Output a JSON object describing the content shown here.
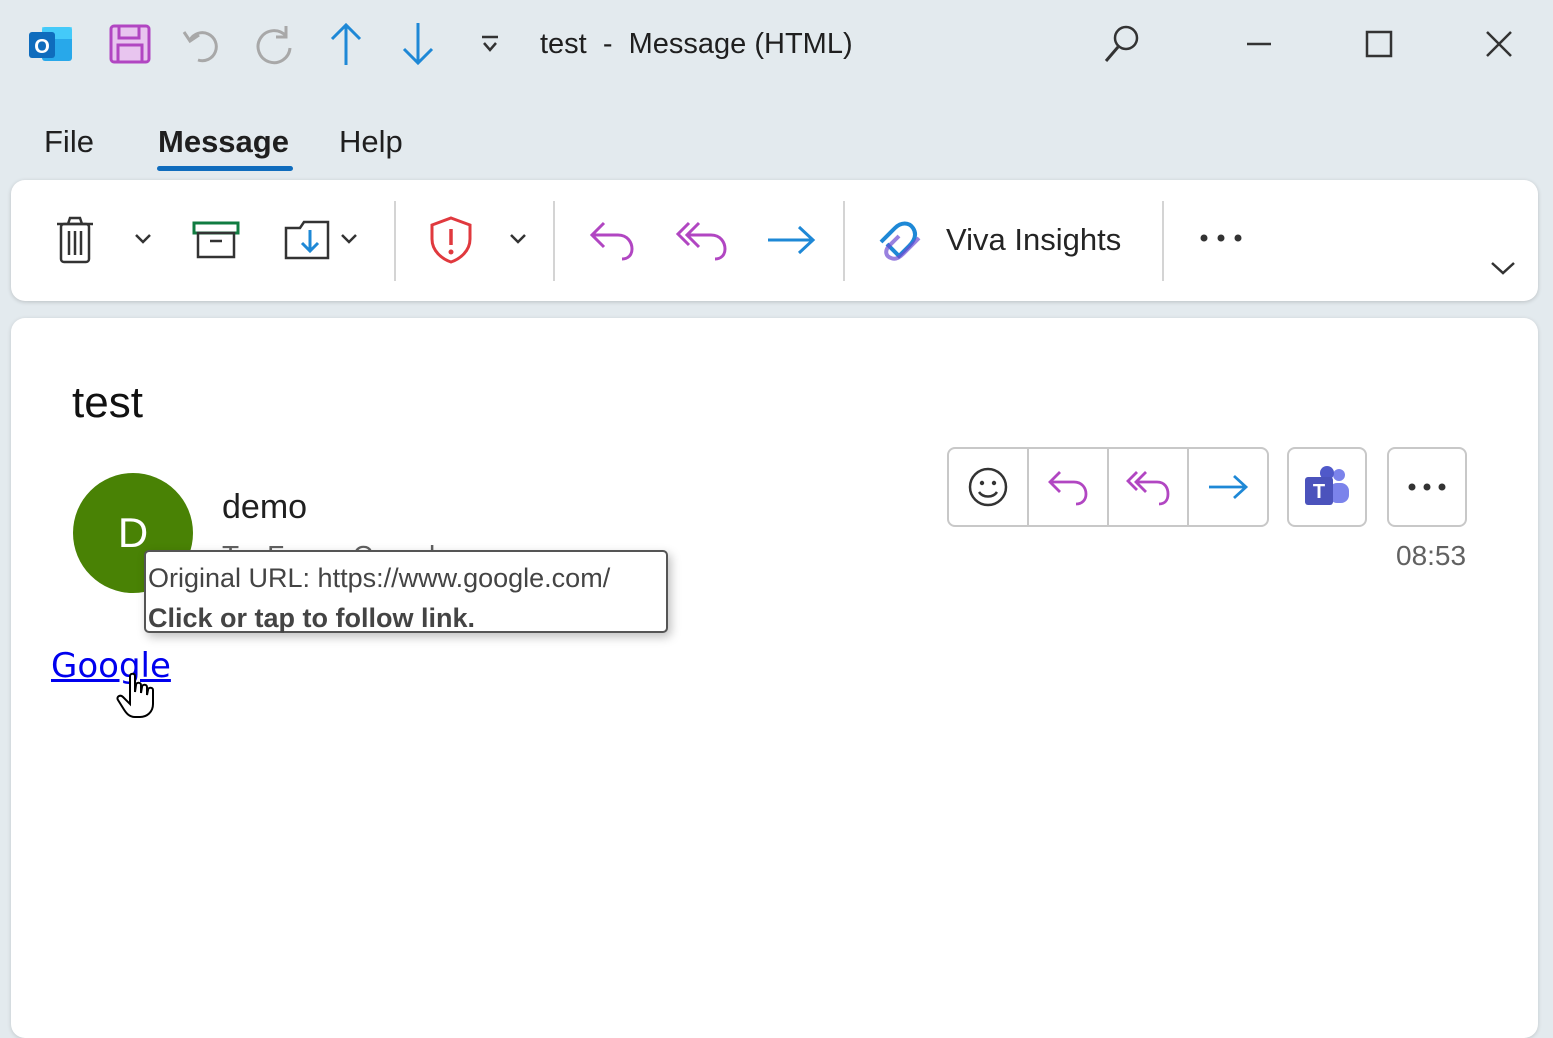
{
  "window": {
    "title": "test  -  Message (HTML)",
    "controls": [
      "minimize",
      "maximize",
      "close"
    ]
  },
  "titlebar_icons": [
    "outlook-logo-icon",
    "save-icon",
    "undo-icon",
    "redo-icon",
    "previous-item-icon",
    "next-item-icon",
    "customize-toolbar-icon",
    "search-icon"
  ],
  "menu": {
    "tabs": [
      "File",
      "Message",
      "Help"
    ],
    "active_tab": "Message"
  },
  "ribbon": {
    "viva_label": "Viva Insights",
    "buttons": [
      "delete",
      "archive",
      "move",
      "report",
      "reply",
      "reply-all",
      "forward",
      "viva-insights",
      "more"
    ]
  },
  "message": {
    "subject": "test",
    "sender_initial": "D",
    "sender_name": "demo",
    "to_line": "To: Fanny Cornel",
    "time": "08:53",
    "body_link": "Google"
  },
  "tooltip": {
    "line1": "Original URL: https://www.google.com/",
    "line2": "Click or tap to follow link."
  },
  "colors": {
    "background": "#e3eaee",
    "accent": "#0f6cbd",
    "avatar": "#498205",
    "reply": "#b146c2",
    "forward": "#1e88d6",
    "report": "#e0393e",
    "teams": "#5059c9",
    "link": "#0000ee"
  }
}
